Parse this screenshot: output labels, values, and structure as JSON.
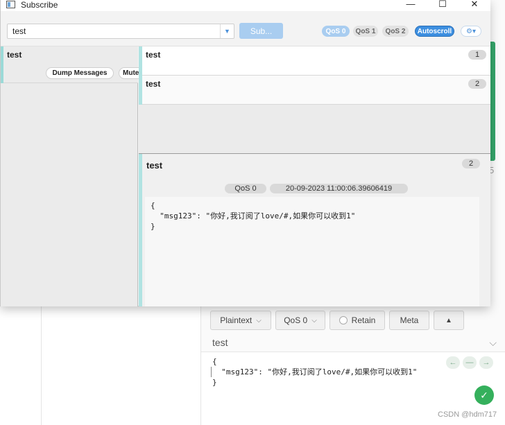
{
  "window": {
    "title": "Subscribe",
    "controls": {
      "minimize": "—",
      "maximize": "☐",
      "close": "✕"
    }
  },
  "toolbar": {
    "topic_value": "test",
    "subscribe_label": "Sub...",
    "qos0": "QoS 0",
    "qos1": "QoS 1",
    "qos2": "QoS 2",
    "autoscroll": "Autoscroll",
    "settings_icon": "⚙▾"
  },
  "subscriptions": [
    {
      "topic": "test",
      "dump_label": "Dump Messages",
      "mute_label": "Mute"
    }
  ],
  "messages": [
    {
      "topic": "test",
      "number": "1"
    },
    {
      "topic": "test",
      "number": "2"
    }
  ],
  "detail": {
    "topic": "test",
    "number": "2",
    "qos": "QoS 0",
    "timestamp": "20-09-2023  11:00:06.39606419",
    "payload": "{\n  \"msg123\": \"你好,我订阅了love/#,如果你可以收到1\"\n}"
  },
  "background": {
    "edge_text": "5",
    "format_label": "Plaintext",
    "qos_label": "QoS 0",
    "retain_label": "Retain",
    "meta_label": "Meta",
    "expand_icon": "▲",
    "topic_value": "test",
    "payload": "{\n  \"msg123\": \"你好,我订阅了love/#,如果你可以收到1\"\n}",
    "nav_back": "←",
    "nav_mid": "—",
    "nav_fwd": "→",
    "fab_icon": "✓",
    "watermark": "CSDN @hdm717"
  }
}
